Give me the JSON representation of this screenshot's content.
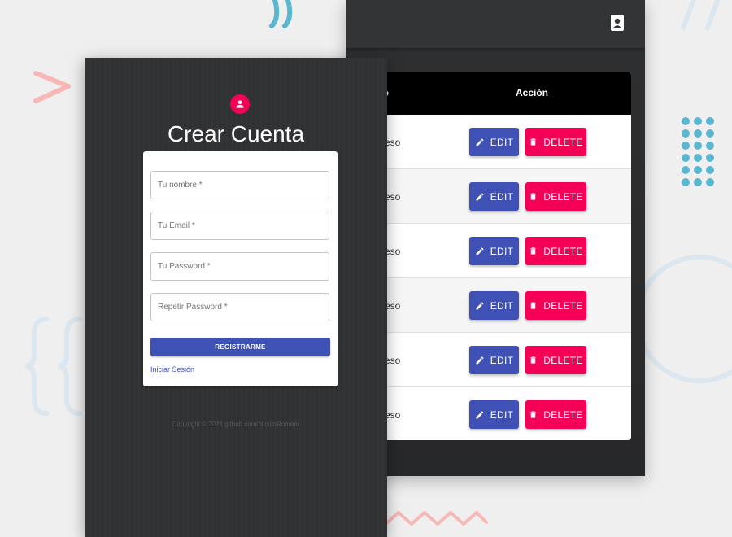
{
  "table_app": {
    "column_tipo": "ipo",
    "column_accion": "Acción",
    "rows": [
      {
        "tipo": "reso",
        "edit": "EDIT",
        "delete": "DELETE"
      },
      {
        "tipo": "reso",
        "edit": "EDIT",
        "delete": "DELETE"
      },
      {
        "tipo": "reso",
        "edit": "EDIT",
        "delete": "DELETE"
      },
      {
        "tipo": "reso",
        "edit": "EDIT",
        "delete": "DELETE"
      },
      {
        "tipo": "reso",
        "edit": "EDIT",
        "delete": "DELETE"
      },
      {
        "tipo": "reso",
        "edit": "EDIT",
        "delete": "DELETE"
      }
    ],
    "icons": {
      "appbar": "contact-card-icon",
      "edit": "pencil-icon",
      "delete": "trash-icon"
    }
  },
  "register": {
    "title": "Crear Cuenta",
    "avatar_icon": "person-icon",
    "fields": {
      "name_placeholder": "Tu nombre *",
      "email_placeholder": "Tu Email *",
      "password_placeholder": "Tu Password *",
      "repeat_password_placeholder": "Repetir Password *"
    },
    "submit_label": "REGISTRARME",
    "login_link": "Iniciar Sesión",
    "copyright": "Copyright © 2021 github.com/NicoloRomero"
  },
  "colors": {
    "primary": "#3f51b5",
    "accent": "#f50057",
    "dark_surface": "#303133",
    "header_black": "#000000",
    "background": "#efefef"
  }
}
